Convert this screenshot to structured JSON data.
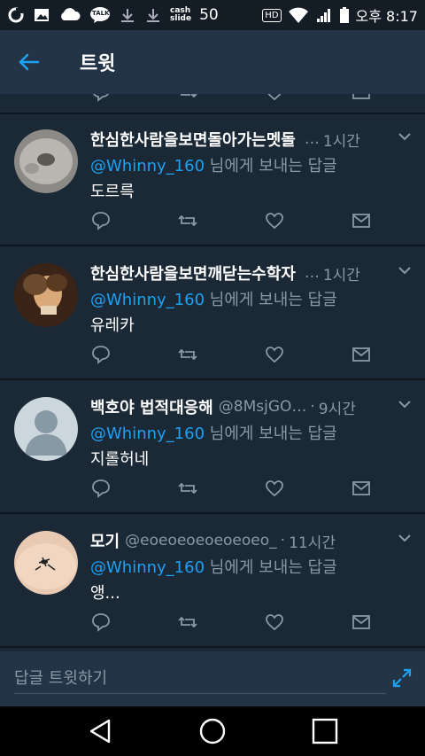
{
  "status_bar": {
    "left_icons": [
      "o-app-icon",
      "gallery-icon",
      "cloud-icon",
      "talk-icon",
      "download-icon",
      "download-icon",
      "cashslide-icon"
    ],
    "talk_label": "TALK",
    "cashslide_line1": "cash",
    "cashslide_line2": "slide",
    "count": "50",
    "hd_label": "HD",
    "time": "오후 8:17"
  },
  "header": {
    "title": "트윗"
  },
  "colors": {
    "accent": "#1da1f2",
    "background": "#1b2836",
    "header": "#243447",
    "muted": "#8899a6"
  },
  "tweets": [
    {
      "name": "한심한사람을보면돌아가는멧돌",
      "handle": "",
      "time": "1시간",
      "reply_mention": "@Whinny_160",
      "reply_suffix": " 님에게 보내는 답글",
      "body": "도르륵"
    },
    {
      "name": "한심한사람을보면깨닫는수학자",
      "handle": "",
      "time": "1시간",
      "reply_mention": "@Whinny_160",
      "reply_suffix": " 님에게 보내는 답글",
      "body": "유레카"
    },
    {
      "name": "백호야 법적대응해",
      "handle": "@8MsjGO…",
      "time": "9시간",
      "reply_mention": "@Whinny_160",
      "reply_suffix": " 님에게 보내는 답글",
      "body": "지롤허네"
    },
    {
      "name": "모기",
      "handle": "@eoeoeoeoeoeoeo_",
      "time": "11시간",
      "reply_mention": "@Whinny_160",
      "reply_suffix": " 님에게 보내는 답글",
      "body": "앵..."
    }
  ],
  "compose": {
    "placeholder": "답글 트윗하기"
  }
}
